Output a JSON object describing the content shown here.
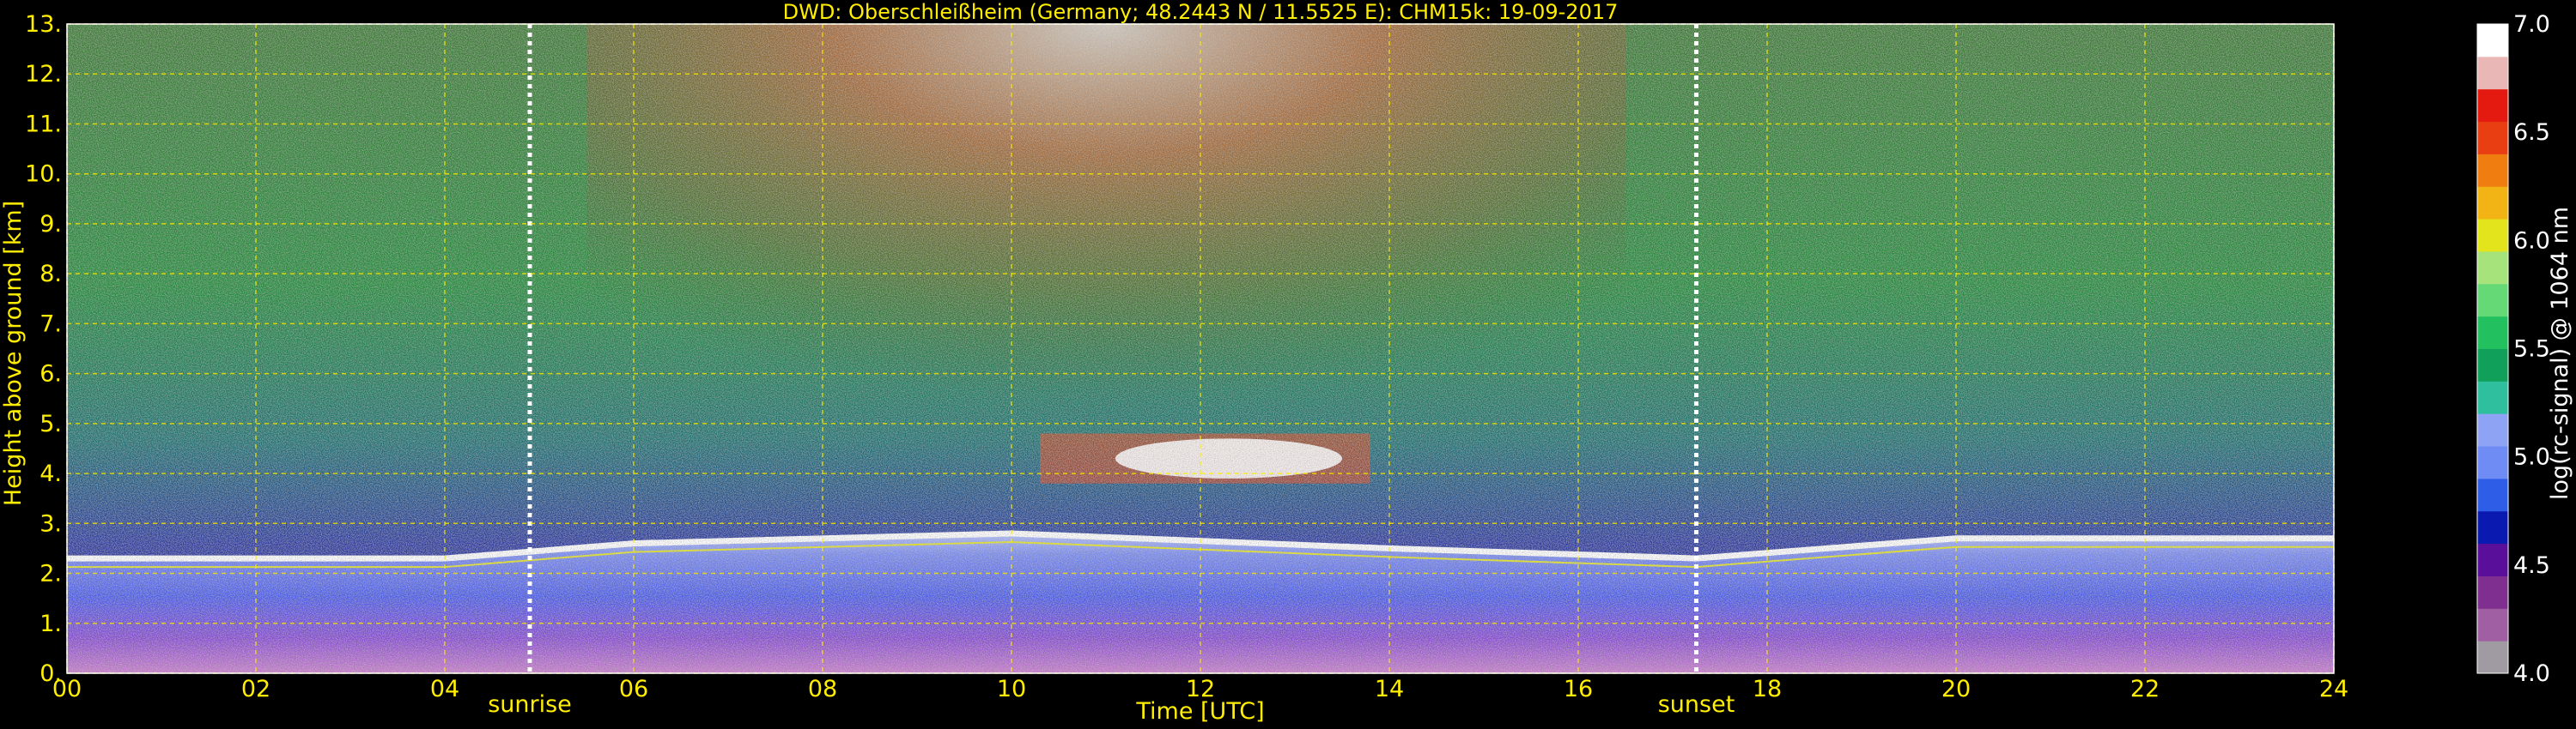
{
  "chart_data": {
    "type": "heatmap",
    "title": "DWD: Oberschleißheim (Germany; 48.2443 N / 11.5525 E):    CHM15k: 19-09-2017",
    "xlabel": "Time [UTC]",
    "ylabel": "Height above ground [km]",
    "xlim": [
      0,
      24
    ],
    "ylim": [
      0,
      13
    ],
    "x_ticks": [
      "00",
      "02",
      "04",
      "06",
      "08",
      "10",
      "12",
      "14",
      "16",
      "18",
      "20",
      "22",
      "24"
    ],
    "y_ticks": [
      "0.",
      "1.",
      "2.",
      "3.",
      "4.",
      "5.",
      "6.",
      "7.",
      "8.",
      "9.",
      "10.",
      "11.",
      "12.",
      "13."
    ],
    "grid": true,
    "grid_style": "dashed-yellow",
    "markers": [
      {
        "label": "sunrise",
        "time": 4.9
      },
      {
        "label": "sunset",
        "time": 17.25
      }
    ],
    "colorbar": {
      "label": "log(rc-signal) @ 1064 nm",
      "range": [
        4.0,
        7.0
      ],
      "ticks": [
        "4.0",
        "4.5",
        "5.0",
        "5.5",
        "6.0",
        "6.5",
        "7.0"
      ],
      "colors": [
        "#a09aa3",
        "#a05fa3",
        "#7f2f8f",
        "#5a0f9a",
        "#0a1ab0",
        "#2e5ee8",
        "#6f8cf5",
        "#8fa3f5",
        "#2fbf9f",
        "#10a05a",
        "#22c05e",
        "#66d977",
        "#a6e37a",
        "#e3e41b",
        "#f2b414",
        "#f07d10",
        "#e83e12",
        "#e41a10",
        "#e9b7b5",
        "#ffffff"
      ]
    },
    "features": {
      "boundary_layer_top_km": [
        {
          "t": 0,
          "h": 2.3
        },
        {
          "t": 4,
          "h": 2.3
        },
        {
          "t": 6,
          "h": 2.6
        },
        {
          "t": 10,
          "h": 2.8
        },
        {
          "t": 14,
          "h": 2.5
        },
        {
          "t": 17.25,
          "h": 2.3
        },
        {
          "t": 20,
          "h": 2.7
        },
        {
          "t": 24,
          "h": 2.7
        }
      ],
      "cloud_layer": {
        "t_start": 10.3,
        "t_end": 13.8,
        "h_bottom": 3.8,
        "h_top": 4.8
      }
    }
  },
  "colors": {
    "accent_text": "#ffee00",
    "marker": "#ffffff",
    "background": "#000000"
  }
}
